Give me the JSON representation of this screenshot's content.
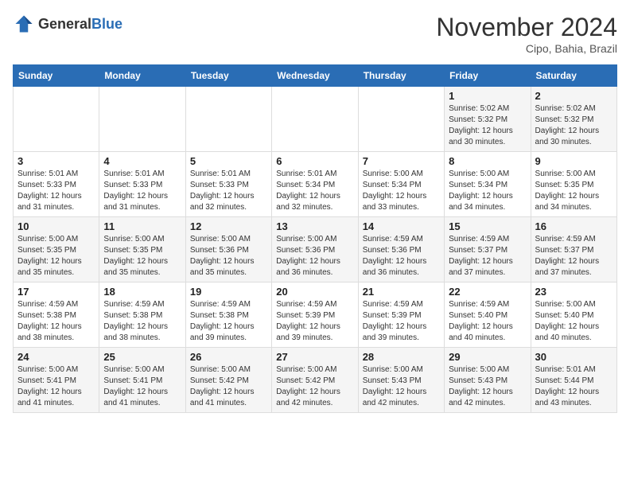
{
  "header": {
    "logo_general": "General",
    "logo_blue": "Blue",
    "month_title": "November 2024",
    "location": "Cipo, Bahia, Brazil"
  },
  "weekdays": [
    "Sunday",
    "Monday",
    "Tuesday",
    "Wednesday",
    "Thursday",
    "Friday",
    "Saturday"
  ],
  "weeks": [
    [
      {
        "day": "",
        "sunrise": "",
        "sunset": "",
        "daylight": ""
      },
      {
        "day": "",
        "sunrise": "",
        "sunset": "",
        "daylight": ""
      },
      {
        "day": "",
        "sunrise": "",
        "sunset": "",
        "daylight": ""
      },
      {
        "day": "",
        "sunrise": "",
        "sunset": "",
        "daylight": ""
      },
      {
        "day": "",
        "sunrise": "",
        "sunset": "",
        "daylight": ""
      },
      {
        "day": "1",
        "sunrise": "Sunrise: 5:02 AM",
        "sunset": "Sunset: 5:32 PM",
        "daylight": "Daylight: 12 hours and 30 minutes."
      },
      {
        "day": "2",
        "sunrise": "Sunrise: 5:02 AM",
        "sunset": "Sunset: 5:32 PM",
        "daylight": "Daylight: 12 hours and 30 minutes."
      }
    ],
    [
      {
        "day": "3",
        "sunrise": "Sunrise: 5:01 AM",
        "sunset": "Sunset: 5:33 PM",
        "daylight": "Daylight: 12 hours and 31 minutes."
      },
      {
        "day": "4",
        "sunrise": "Sunrise: 5:01 AM",
        "sunset": "Sunset: 5:33 PM",
        "daylight": "Daylight: 12 hours and 31 minutes."
      },
      {
        "day": "5",
        "sunrise": "Sunrise: 5:01 AM",
        "sunset": "Sunset: 5:33 PM",
        "daylight": "Daylight: 12 hours and 32 minutes."
      },
      {
        "day": "6",
        "sunrise": "Sunrise: 5:01 AM",
        "sunset": "Sunset: 5:34 PM",
        "daylight": "Daylight: 12 hours and 32 minutes."
      },
      {
        "day": "7",
        "sunrise": "Sunrise: 5:00 AM",
        "sunset": "Sunset: 5:34 PM",
        "daylight": "Daylight: 12 hours and 33 minutes."
      },
      {
        "day": "8",
        "sunrise": "Sunrise: 5:00 AM",
        "sunset": "Sunset: 5:34 PM",
        "daylight": "Daylight: 12 hours and 34 minutes."
      },
      {
        "day": "9",
        "sunrise": "Sunrise: 5:00 AM",
        "sunset": "Sunset: 5:35 PM",
        "daylight": "Daylight: 12 hours and 34 minutes."
      }
    ],
    [
      {
        "day": "10",
        "sunrise": "Sunrise: 5:00 AM",
        "sunset": "Sunset: 5:35 PM",
        "daylight": "Daylight: 12 hours and 35 minutes."
      },
      {
        "day": "11",
        "sunrise": "Sunrise: 5:00 AM",
        "sunset": "Sunset: 5:35 PM",
        "daylight": "Daylight: 12 hours and 35 minutes."
      },
      {
        "day": "12",
        "sunrise": "Sunrise: 5:00 AM",
        "sunset": "Sunset: 5:36 PM",
        "daylight": "Daylight: 12 hours and 35 minutes."
      },
      {
        "day": "13",
        "sunrise": "Sunrise: 5:00 AM",
        "sunset": "Sunset: 5:36 PM",
        "daylight": "Daylight: 12 hours and 36 minutes."
      },
      {
        "day": "14",
        "sunrise": "Sunrise: 4:59 AM",
        "sunset": "Sunset: 5:36 PM",
        "daylight": "Daylight: 12 hours and 36 minutes."
      },
      {
        "day": "15",
        "sunrise": "Sunrise: 4:59 AM",
        "sunset": "Sunset: 5:37 PM",
        "daylight": "Daylight: 12 hours and 37 minutes."
      },
      {
        "day": "16",
        "sunrise": "Sunrise: 4:59 AM",
        "sunset": "Sunset: 5:37 PM",
        "daylight": "Daylight: 12 hours and 37 minutes."
      }
    ],
    [
      {
        "day": "17",
        "sunrise": "Sunrise: 4:59 AM",
        "sunset": "Sunset: 5:38 PM",
        "daylight": "Daylight: 12 hours and 38 minutes."
      },
      {
        "day": "18",
        "sunrise": "Sunrise: 4:59 AM",
        "sunset": "Sunset: 5:38 PM",
        "daylight": "Daylight: 12 hours and 38 minutes."
      },
      {
        "day": "19",
        "sunrise": "Sunrise: 4:59 AM",
        "sunset": "Sunset: 5:38 PM",
        "daylight": "Daylight: 12 hours and 39 minutes."
      },
      {
        "day": "20",
        "sunrise": "Sunrise: 4:59 AM",
        "sunset": "Sunset: 5:39 PM",
        "daylight": "Daylight: 12 hours and 39 minutes."
      },
      {
        "day": "21",
        "sunrise": "Sunrise: 4:59 AM",
        "sunset": "Sunset: 5:39 PM",
        "daylight": "Daylight: 12 hours and 39 minutes."
      },
      {
        "day": "22",
        "sunrise": "Sunrise: 4:59 AM",
        "sunset": "Sunset: 5:40 PM",
        "daylight": "Daylight: 12 hours and 40 minutes."
      },
      {
        "day": "23",
        "sunrise": "Sunrise: 5:00 AM",
        "sunset": "Sunset: 5:40 PM",
        "daylight": "Daylight: 12 hours and 40 minutes."
      }
    ],
    [
      {
        "day": "24",
        "sunrise": "Sunrise: 5:00 AM",
        "sunset": "Sunset: 5:41 PM",
        "daylight": "Daylight: 12 hours and 41 minutes."
      },
      {
        "day": "25",
        "sunrise": "Sunrise: 5:00 AM",
        "sunset": "Sunset: 5:41 PM",
        "daylight": "Daylight: 12 hours and 41 minutes."
      },
      {
        "day": "26",
        "sunrise": "Sunrise: 5:00 AM",
        "sunset": "Sunset: 5:42 PM",
        "daylight": "Daylight: 12 hours and 41 minutes."
      },
      {
        "day": "27",
        "sunrise": "Sunrise: 5:00 AM",
        "sunset": "Sunset: 5:42 PM",
        "daylight": "Daylight: 12 hours and 42 minutes."
      },
      {
        "day": "28",
        "sunrise": "Sunrise: 5:00 AM",
        "sunset": "Sunset: 5:43 PM",
        "daylight": "Daylight: 12 hours and 42 minutes."
      },
      {
        "day": "29",
        "sunrise": "Sunrise: 5:00 AM",
        "sunset": "Sunset: 5:43 PM",
        "daylight": "Daylight: 12 hours and 42 minutes."
      },
      {
        "day": "30",
        "sunrise": "Sunrise: 5:01 AM",
        "sunset": "Sunset: 5:44 PM",
        "daylight": "Daylight: 12 hours and 43 minutes."
      }
    ]
  ]
}
